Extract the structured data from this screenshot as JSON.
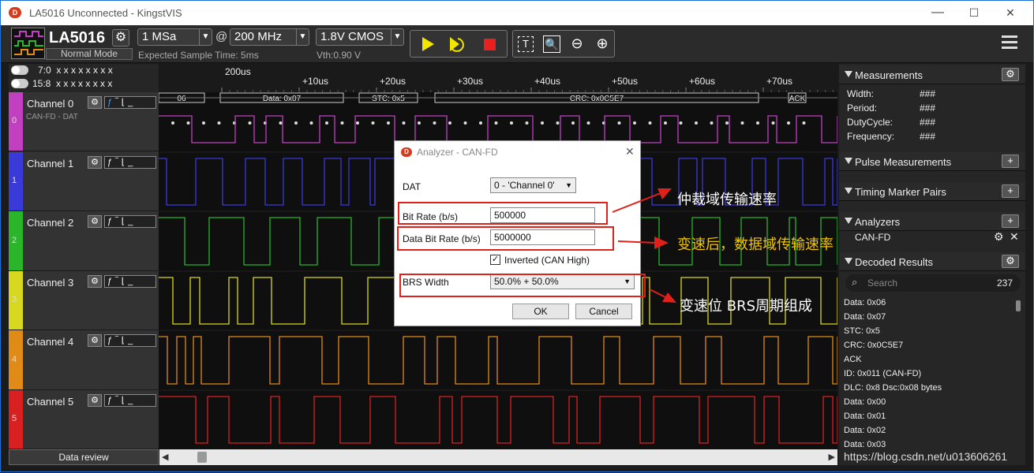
{
  "titlebar": {
    "title": "LA5016 Unconnected - KingstVIS",
    "minimize": "—",
    "maximize": "☐",
    "close": "✕"
  },
  "toolbar": {
    "device_name": "LA5016",
    "device_mode": "Normal Mode",
    "sample_depth": "1 MSa",
    "at": "@",
    "sample_rate": "200 MHz",
    "threshold": "1.8V CMOS",
    "expected_time": "Expected Sample Time: 5ms",
    "vth": "Vth:0.90 V"
  },
  "time_header": {
    "row1": "7:0  x x x x x x x x",
    "row2": "15:8  x x x x x x x x",
    "ticks": [
      "200us",
      "+10us",
      "+20us",
      "+30us",
      "+40us",
      "+50us",
      "+60us",
      "+70us"
    ]
  },
  "channels": [
    {
      "name": "Channel 0",
      "index": "0",
      "sub": "CAN-FD - DAT",
      "color": "#c040c0"
    },
    {
      "name": "Channel 1",
      "index": "1",
      "sub": "",
      "color": "#3a3ad8"
    },
    {
      "name": "Channel 2",
      "index": "2",
      "sub": "",
      "color": "#2ab52a"
    },
    {
      "name": "Channel 3",
      "index": "3",
      "sub": "",
      "color": "#d8d820"
    },
    {
      "name": "Channel 4",
      "index": "4",
      "sub": "",
      "color": "#e08a18"
    },
    {
      "name": "Channel 5",
      "index": "5",
      "sub": "",
      "color": "#d82020"
    }
  ],
  "decode_bar": {
    "labels": [
      "06",
      "Data: 0x07",
      "STC: 0x5",
      "CRC: 0x0C5E7",
      "ACK"
    ]
  },
  "bottom": {
    "data_review": "Data review"
  },
  "right_panel": {
    "measurements": {
      "title": "Measurements",
      "rows": [
        {
          "k": "Width:",
          "v": "###"
        },
        {
          "k": "Period:",
          "v": "###"
        },
        {
          "k": "DutyCycle:",
          "v": "###"
        },
        {
          "k": "Frequency:",
          "v": "###"
        }
      ]
    },
    "pulse": "Pulse Measurements",
    "timing": "Timing Marker Pairs",
    "analyzers": {
      "title": "Analyzers",
      "item": "CAN-FD"
    },
    "decoded": {
      "title": "Decoded Results",
      "search_placeholder": "Search",
      "count": "237",
      "results": [
        "Data: 0x06",
        "Data: 0x07",
        "STC: 0x5",
        "CRC: 0x0C5E7",
        "ACK",
        "ID: 0x011 (CAN-FD)",
        "DLC: 0x8 Dsc:0x08 bytes",
        "Data: 0x00",
        "Data: 0x01",
        "Data: 0x02",
        "Data: 0x03"
      ]
    }
  },
  "dialog": {
    "title": "Analyzer - CAN-FD",
    "dat_label": "DAT",
    "dat_value": "0 - 'Channel 0'",
    "bitrate_label": "Bit Rate (b/s)",
    "bitrate_value": "500000",
    "databitrate_label": "Data Bit Rate (b/s)",
    "databitrate_value": "5000000",
    "inverted_label": "Inverted (CAN High)",
    "brs_label": "BRS Width",
    "brs_value": "50.0% + 50.0%",
    "ok": "OK",
    "cancel": "Cancel"
  },
  "annotations": {
    "a1": "仲裁域传输速率",
    "a2": "变速后，数据域传输速率",
    "a3": "变速位 BRS周期组成",
    "watermark": "https://blog.csdn.net/u013606261"
  }
}
